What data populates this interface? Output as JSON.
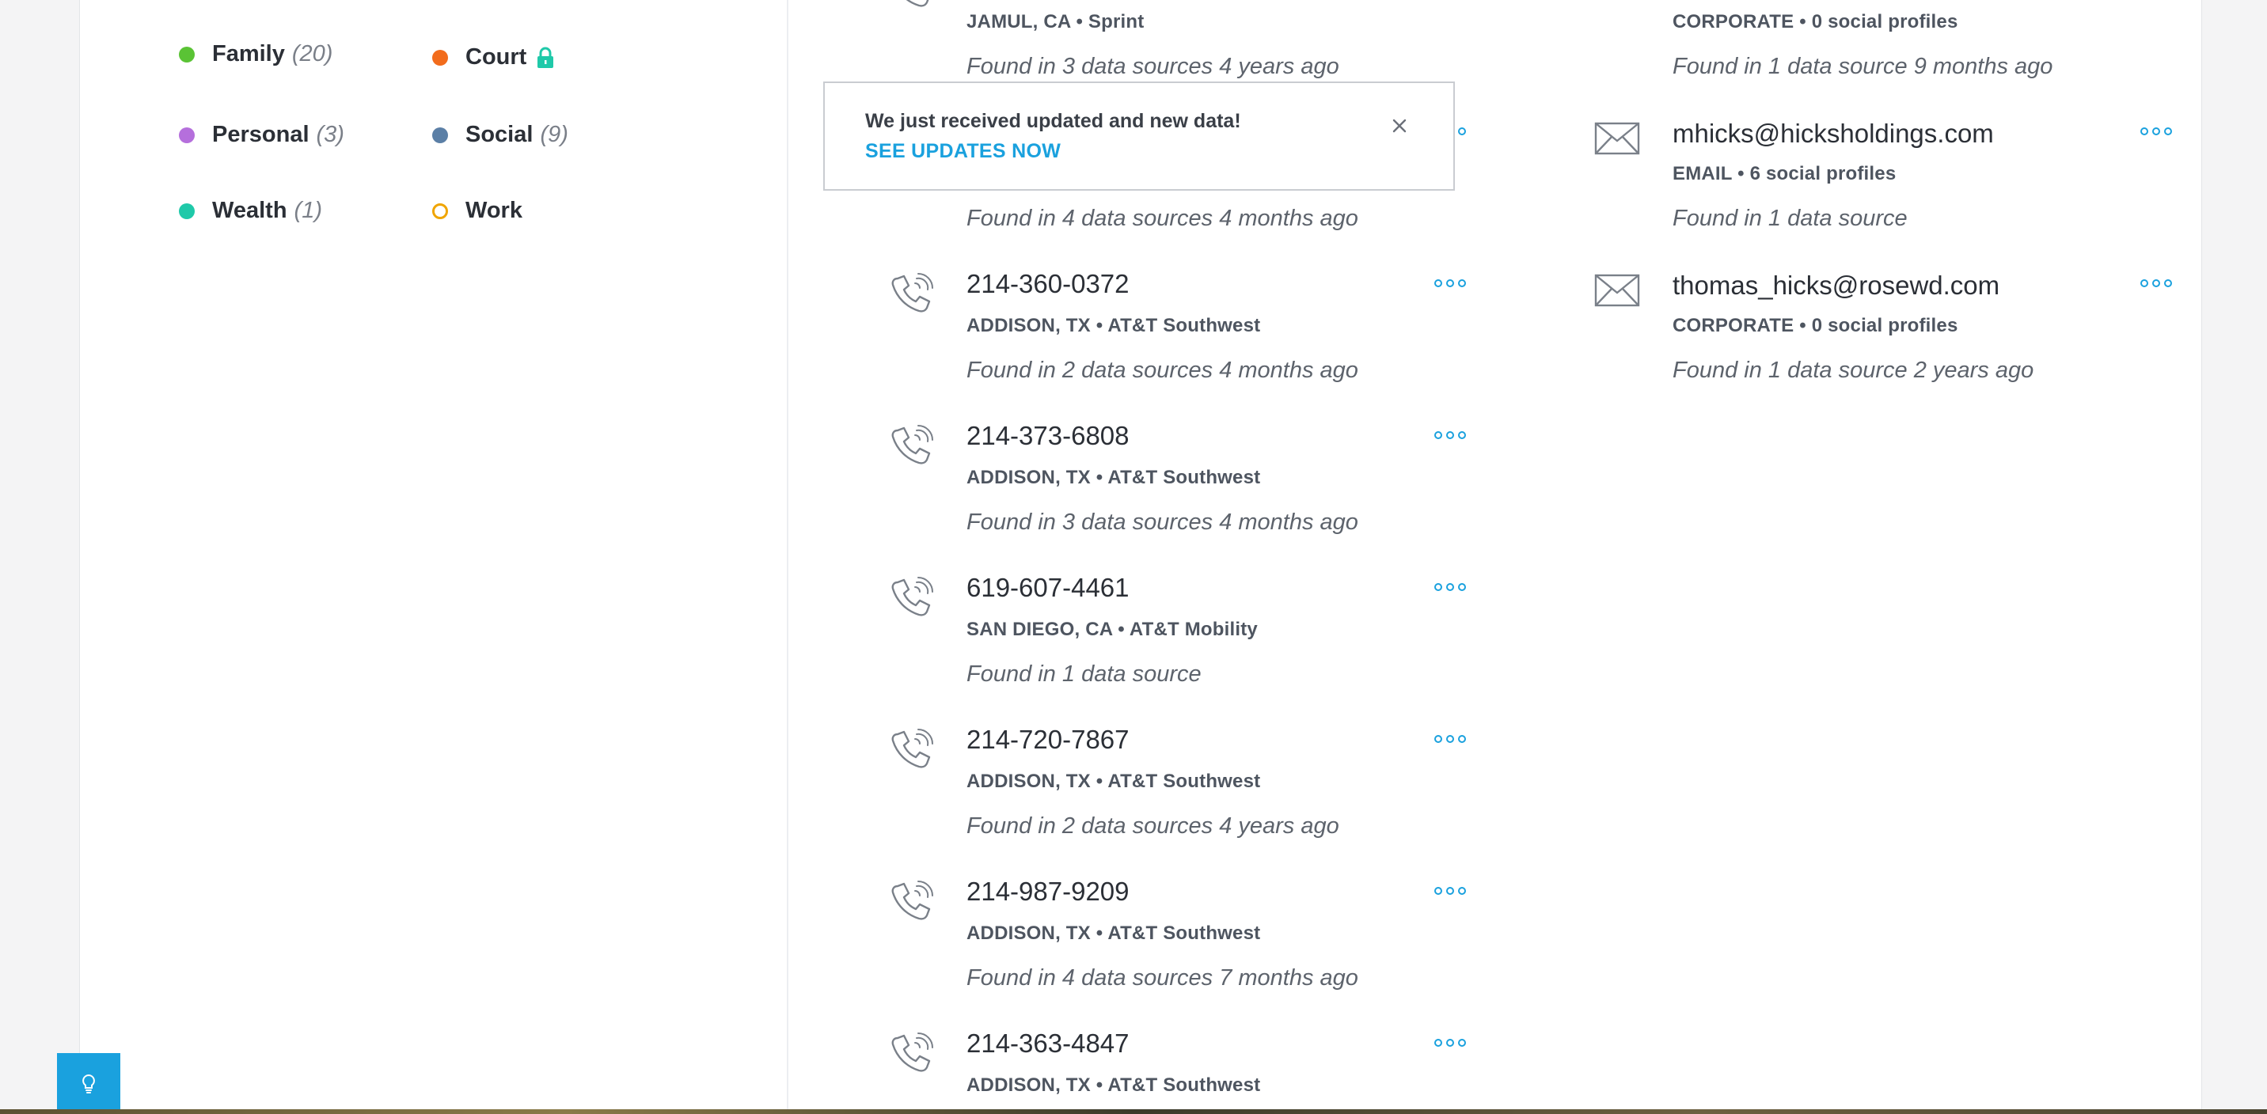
{
  "colors": {
    "family": "#5ac335",
    "court": "#f26c1c",
    "personal": "#b56fdc",
    "social": "#5b7fa6",
    "wealth": "#1fc9a9",
    "work": "#f0a500",
    "accent": "#1aa1de"
  },
  "legend": [
    {
      "label": "Family",
      "count": "(20)",
      "icon": "dot"
    },
    {
      "label": "Court",
      "count": "",
      "icon": "lock-icon"
    },
    {
      "label": "Personal",
      "count": "(3)",
      "icon": "dot"
    },
    {
      "label": "Social",
      "count": "(9)",
      "icon": "dot"
    },
    {
      "label": "Wealth",
      "count": "(1)",
      "icon": "dot"
    },
    {
      "label": "Work",
      "count": "",
      "icon": "ring"
    }
  ],
  "phones": {
    "partial_top": {
      "meta": "JAMUL, CA • Sprint",
      "found": "Found in 3 data sources 4 years ago"
    },
    "hidden_found": "Found in 4 data sources 4 months ago",
    "items": [
      {
        "number": "214-360-0372",
        "meta": "ADDISON, TX • AT&T Southwest",
        "found": "Found in 2 data sources 4 months ago"
      },
      {
        "number": "214-373-6808",
        "meta": "ADDISON, TX • AT&T Southwest",
        "found": "Found in 3 data sources 4 months ago"
      },
      {
        "number": "619-607-4461",
        "meta": "SAN DIEGO, CA • AT&T Mobility",
        "found": "Found in 1 data source"
      },
      {
        "number": "214-720-7867",
        "meta": "ADDISON, TX • AT&T Southwest",
        "found": "Found in 2 data sources 4 years ago"
      },
      {
        "number": "214-987-9209",
        "meta": "ADDISON, TX • AT&T Southwest",
        "found": "Found in 4 data sources 7 months ago"
      },
      {
        "number": "214-363-4847",
        "meta": "ADDISON, TX • AT&T Southwest",
        "found": ""
      }
    ]
  },
  "emails": {
    "partial_top": {
      "meta": "CORPORATE • 0 social profiles",
      "found": "Found in 1 data source 9 months ago"
    },
    "items": [
      {
        "address": "mhicks@hicksholdings.com",
        "meta": "EMAIL • 6 social profiles",
        "found": "Found in 1 data source"
      },
      {
        "address": "thomas_hicks@rosewd.com",
        "meta": "CORPORATE • 0 social profiles",
        "found": "Found in 1 data source 2 years ago"
      }
    ]
  },
  "toast": {
    "message": "We just received updated and new data!",
    "link": "SEE UPDATES NOW"
  },
  "help_button": {
    "icon": "lightbulb-icon"
  }
}
